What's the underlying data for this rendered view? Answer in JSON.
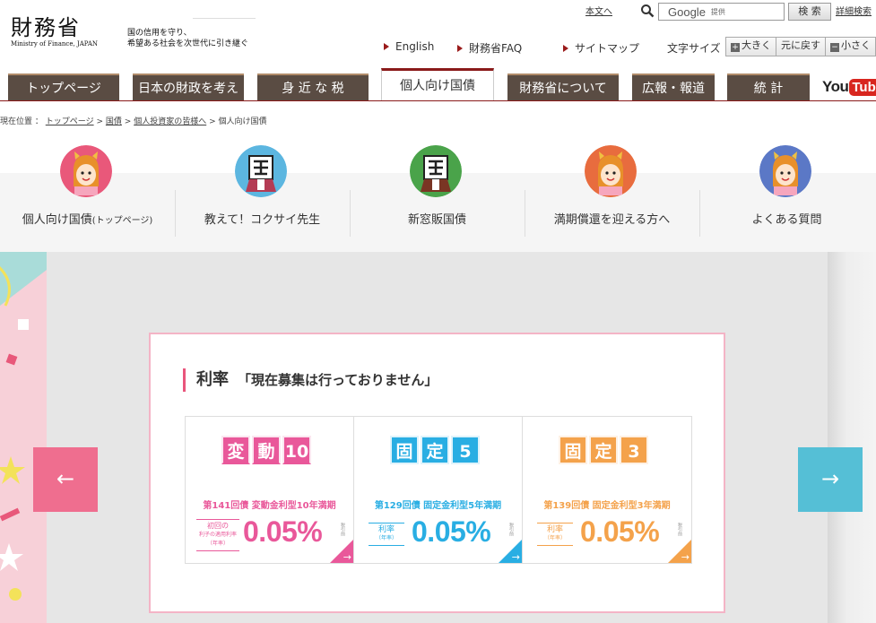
{
  "header": {
    "logo_kanji": "財務省",
    "logo_en": "Ministry of Finance, JAPAN",
    "tagline_1": "国の信用を守り、",
    "tagline_2": "希望ある社会を次世代に引き継ぐ",
    "skip_link": "本文へ",
    "search": {
      "brand": "Google",
      "provider": "提供",
      "button": "検 索",
      "advanced": "詳細検索"
    },
    "subnav": [
      "English",
      "財務省FAQ",
      "サイトマップ"
    ],
    "font_size": {
      "label": "文字サイズ",
      "larger": "大きく",
      "reset": "元に戻す",
      "smaller": "小さく"
    }
  },
  "tabs": [
    "トップページ",
    "日本の財政を考える",
    "身 近 な 税",
    "個人向け国債",
    "財務省について",
    "広報・報道",
    "統 計"
  ],
  "active_tab_index": 3,
  "youtube": {
    "you": "You",
    "tube": "Tube"
  },
  "breadcrumb": {
    "prefix": "現在位置 ：",
    "items": [
      "トップページ",
      "国債",
      "個人投資家の皆様へ"
    ],
    "current": "個人向け国債",
    "sep": ">"
  },
  "submenu": [
    {
      "label": "個人向け国債",
      "suffix": "(トップページ)",
      "color": "#e9587a",
      "icon": "mascot-girl-icon"
    },
    {
      "label": "教えて！コクサイ先生",
      "color": "#5cb6e0",
      "icon": "kokusai-sensei-icon"
    },
    {
      "label": "新窓販国債",
      "color": "#4aa34a",
      "icon": "shinmadohan-icon"
    },
    {
      "label": "満期償還を迎える方へ",
      "color": "#e86c3e",
      "icon": "mascot-girl-icon"
    },
    {
      "label": "よくある質問",
      "color": "#5b78c6",
      "icon": "mascot-girl-icon"
    }
  ],
  "slider": {
    "prev_label": "←",
    "next_label": "→",
    "title": "利率",
    "status": "「現在募集は行っておりません」",
    "cards": [
      {
        "chars": [
          "変",
          "動",
          "10"
        ],
        "issue": "第141回債 変動金利型10年満期",
        "rate_label_1": "初回の",
        "rate_label_2": "利子の適用利率",
        "rate_label_3": "（年率）",
        "rate": "0.05%",
        "side": "税引前"
      },
      {
        "chars": [
          "固",
          "定",
          "5"
        ],
        "issue": "第129回債 固定金利型5年満期",
        "rate_label_1": "利率",
        "rate_label_2": "（年率）",
        "rate_label_3": "",
        "rate": "0.05%",
        "side": "税引前"
      },
      {
        "chars": [
          "固",
          "定",
          "3"
        ],
        "issue": "第139回債 固定金利型3年満期",
        "rate_label_1": "利率",
        "rate_label_2": "（年率）",
        "rate_label_3": "",
        "rate": "0.05%",
        "side": "税引前"
      }
    ]
  }
}
